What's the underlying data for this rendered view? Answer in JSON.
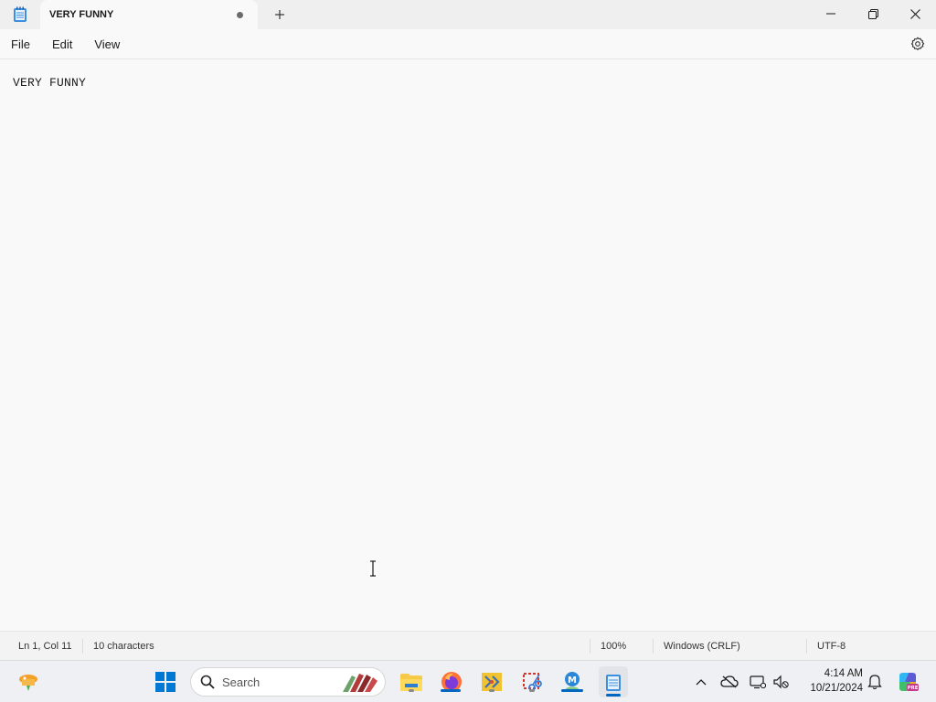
{
  "window": {
    "tab_title": "VERY FUNNY"
  },
  "menu": {
    "file": "File",
    "edit": "Edit",
    "view": "View"
  },
  "editor": {
    "content": "VERY FUNNY"
  },
  "status": {
    "position": "Ln 1, Col 11",
    "characters": "10 characters",
    "zoom": "100%",
    "line_ending": "Windows (CRLF)",
    "encoding": "UTF-8"
  },
  "taskbar": {
    "search_label": "Search",
    "time": "4:14 AM",
    "date": "10/21/2024"
  },
  "colors": {
    "accent": "#0067c0",
    "background": "#f9f9f9"
  }
}
